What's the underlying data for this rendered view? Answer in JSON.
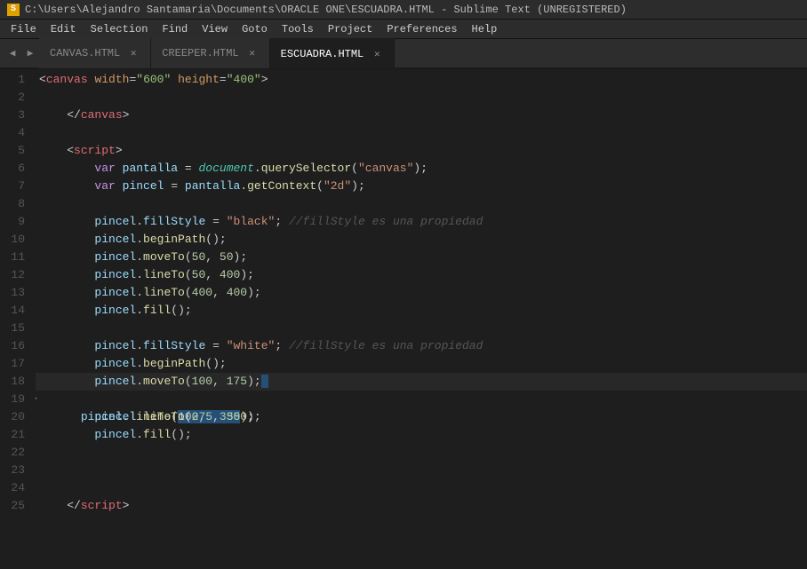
{
  "titlebar": {
    "icon": "ST",
    "text": "C:\\Users\\Alejandro Santamaria\\Documents\\ORACLE ONE\\ESCUADRA.HTML - Sublime Text (UNREGISTERED)"
  },
  "menubar": {
    "items": [
      "File",
      "Edit",
      "Selection",
      "Find",
      "View",
      "Goto",
      "Tools",
      "Project",
      "Preferences",
      "Help"
    ]
  },
  "tabs": [
    {
      "id": "canvas",
      "label": "CANVAS.HTML",
      "active": false
    },
    {
      "id": "creeper",
      "label": "CREEPER.HTML",
      "active": false
    },
    {
      "id": "escuadra",
      "label": "ESCUADRA.HTML",
      "active": true
    }
  ],
  "lines": {
    "count": 25
  }
}
